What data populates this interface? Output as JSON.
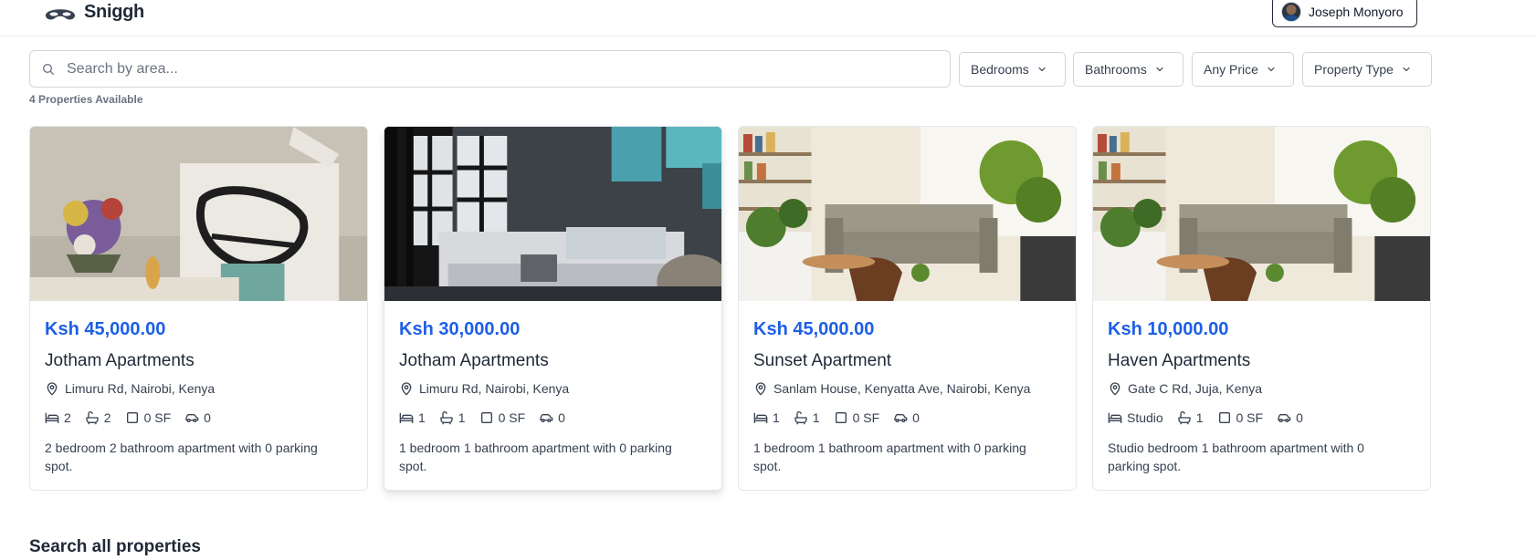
{
  "header": {
    "brand": "Sniggh",
    "user_name": "Joseph Monyoro"
  },
  "search": {
    "placeholder": "Search by area..."
  },
  "filters": {
    "bedrooms": "Bedrooms",
    "bathrooms": "Bathrooms",
    "price": "Any Price",
    "property_type": "Property Type"
  },
  "results": {
    "count_label": "4 Properties Available"
  },
  "listings": [
    {
      "price": "Ksh 45,000.00",
      "name": "Jotham Apartments",
      "address": "Limuru Rd, Nairobi, Kenya",
      "bedrooms": "2",
      "bathrooms": "2",
      "area": "0 SF",
      "parking": "0",
      "description": "2 bedroom 2 bathroom apartment with 0 parking spot."
    },
    {
      "price": "Ksh 30,000.00",
      "name": "Jotham Apartments",
      "address": "Limuru Rd, Nairobi, Kenya",
      "bedrooms": "1",
      "bathrooms": "1",
      "area": "0 SF",
      "parking": "0",
      "description": "1 bedroom 1 bathroom apartment with 0 parking spot."
    },
    {
      "price": "Ksh 45,000.00",
      "name": "Sunset Apartment",
      "address": "Sanlam House, Kenyatta Ave, Nairobi, Kenya",
      "bedrooms": "1",
      "bathrooms": "1",
      "area": "0 SF",
      "parking": "0",
      "description": "1 bedroom 1 bathroom apartment with 0 parking spot."
    },
    {
      "price": "Ksh 10,000.00",
      "name": "Haven Apartments",
      "address": "Gate C Rd, Juja, Kenya",
      "bedrooms": "Studio",
      "bathrooms": "1",
      "area": "0 SF",
      "parking": "0",
      "description": "Studio bedroom 1 bathroom apartment with 0 parking spot."
    }
  ],
  "sections": {
    "search_all_title": "Search all properties"
  },
  "icons": {
    "logo": "mask-logo-icon",
    "search": "search-icon",
    "dropdown": "chevron-down-icon",
    "location": "map-pin-icon",
    "bed": "bed-icon",
    "bath": "bath-icon",
    "area": "square-icon",
    "parking": "car-icon"
  },
  "colors": {
    "price": "#1d5fe6",
    "text": "#1f2937",
    "border": "#d1d5db"
  }
}
